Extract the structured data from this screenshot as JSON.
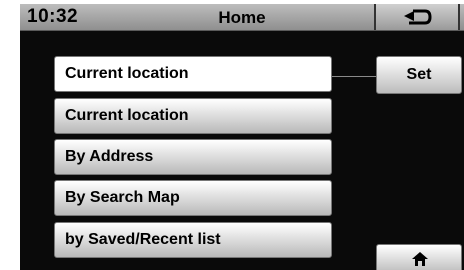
{
  "status_bar": {
    "clock": "10:32",
    "title": "Home",
    "back_icon": "return-arrow"
  },
  "menu": {
    "items": [
      {
        "label": "Current location",
        "selected": true
      },
      {
        "label": "Current location"
      },
      {
        "label": "By Address"
      },
      {
        "label": "By Search Map"
      },
      {
        "label": "by Saved/Recent list"
      }
    ]
  },
  "actions": {
    "set_label": "Set",
    "home_icon": "house"
  }
}
